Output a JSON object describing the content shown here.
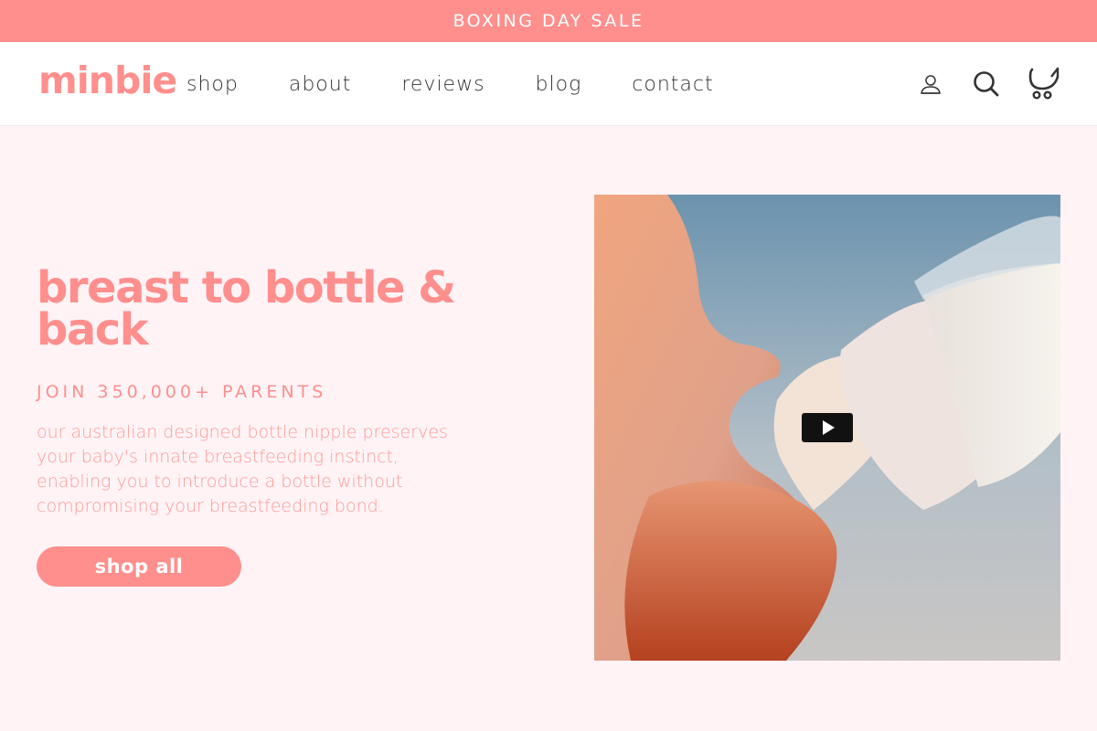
{
  "announcement": {
    "text": "BOXING DAY SALE"
  },
  "header": {
    "logo_text": "minbie",
    "nav": [
      {
        "label": "shop"
      },
      {
        "label": "about"
      },
      {
        "label": "reviews"
      },
      {
        "label": "blog"
      },
      {
        "label": "contact"
      }
    ],
    "icons": [
      "user-icon",
      "search-icon",
      "cart-icon"
    ]
  },
  "hero": {
    "title": "breast to bottle & back",
    "subtitle": "JOIN 350,000+ PARENTS",
    "body": "our australian designed bottle nipple preserves your baby's innate breastfeeding instinct, enabling you to introduce a bottle without compromising your breastfeeding bond.",
    "cta_label": "shop all"
  },
  "video": {
    "play_icon": "play-icon"
  },
  "colors": {
    "brand": "#ff8f8d",
    "background": "#fff3f6",
    "nav_text": "#333333"
  }
}
